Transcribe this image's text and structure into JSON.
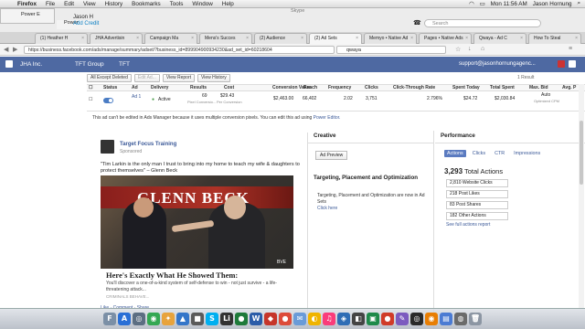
{
  "menubar": {
    "app": "Firefox",
    "items": [
      "File",
      "Edit",
      "View",
      "History",
      "Bookmarks",
      "Tools",
      "Window",
      "Help"
    ],
    "time": "Mon 11:56 AM",
    "user": "Jason Hornung"
  },
  "skype": {
    "title": "Skype",
    "user": "Jason H",
    "add_credit": "Add Credit",
    "search_placeholder": "Search",
    "ff_window": "Power E",
    "ff_window2": "Power"
  },
  "tabs": [
    "(1) Heather H",
    "JHA Advertisin",
    "Campaign Ma",
    "Mens's Succes",
    "(2) Audience",
    "(2) Ad Sets",
    "Memyo • Native Ad",
    "Pages • Native Ads",
    "Qwaya - Ad C",
    "How To Steal"
  ],
  "active_tab": 5,
  "url": "https://business.facebook.com/ads/manage/summary/adset/?business_id=899904900934230&ad_set_id=60218604",
  "search_value": "qwaya",
  "fb": {
    "brand": "JHA Inc.",
    "group": "TFT Group",
    "account": "TFT",
    "email": "support@jasonhornungagenc..."
  },
  "toolbar": {
    "filter": "All Except Deleted",
    "edit": "Edit Ad...",
    "report": "View Report",
    "history": "View History"
  },
  "result_count": "1 Result",
  "table": {
    "headers": [
      "Status",
      "Ad",
      "Delivery",
      "Results",
      "Cost",
      "Conversion Value",
      "Reach",
      "Frequency",
      "Clicks",
      "Click-Through Rate",
      "Spent Today",
      "Total Spent",
      "Max. Bid",
      "Avg. P"
    ],
    "row": {
      "ad": "Ad 1",
      "delivery": "Active",
      "results": "69",
      "results_sub": "Pixel Conversio...",
      "cost": "$29.43",
      "cost_sub": "Per Conversion",
      "conv_value": "$2,463.00",
      "reach": "66,402",
      "frequency": "2.02",
      "clicks": "3,751",
      "ctr": "2.796%",
      "spent_today": "$24.72",
      "total_spent": "$2,030.84",
      "max_bid": "Auto",
      "max_bid_sub": "Optimized CPM"
    }
  },
  "note": {
    "text": "This ad can't be edited in Ads Manager because it uses multiple conversion pixels. You can edit this ad using ",
    "link": "Power Editor."
  },
  "ad": {
    "page": "Target Focus Training",
    "sponsored": "Sponsored",
    "quote": "\"Tim Larkin is the only man I trust to bring into my home to teach my wife & daughters to protect themselves\" – Glenn Beck",
    "banner": "GLENN BECK",
    "watermark": "BVE",
    "headline": "Here's Exactly What He Showed Them:",
    "description": "You'll discover a one-of-a-kind system of self-defense to win - not just survive - a life-threatening attack...",
    "source": "CRIMINALS BEHAVE...",
    "actions": "Like · Comment · Share"
  },
  "creative": {
    "title": "Creative",
    "preview_btn": "Ad Preview",
    "tp_title": "Targeting, Placement and Optimization",
    "tp_text": "Targeting, Placement and Optimization are now in Ad Sets",
    "tp_link": "Click here"
  },
  "performance": {
    "title": "Performance",
    "tabs": [
      "Actions",
      "Clicks",
      "CTR",
      "Impressions"
    ],
    "total_num": "3,293",
    "total_label": "Total Actions",
    "metrics": [
      "2,810 Website Clicks",
      "218 Post Likes",
      "83 Post Shares",
      "182 Other Actions"
    ],
    "link": "See full actions report"
  },
  "dock": [
    {
      "g": "F",
      "c": "#7b8fa6"
    },
    {
      "g": "A",
      "c": "#2a6fd6"
    },
    {
      "g": "◎",
      "c": "#5c6e82"
    },
    {
      "g": "◉",
      "c": "#34a853"
    },
    {
      "g": "✦",
      "c": "#e8a33c"
    },
    {
      "g": "▲",
      "c": "#3576c9"
    },
    {
      "g": "■",
      "c": "#5a5a5a"
    },
    {
      "g": "S",
      "c": "#00aff0"
    },
    {
      "g": "Li",
      "c": "#333"
    },
    {
      "g": "●",
      "c": "#1e7a3a"
    },
    {
      "g": "W",
      "c": "#2b5ca8"
    },
    {
      "g": "◆",
      "c": "#c6352a"
    },
    {
      "g": "●",
      "c": "#dd4b39"
    },
    {
      "g": "✉",
      "c": "#6a9bd8"
    },
    {
      "g": "◐",
      "c": "#f0b400"
    },
    {
      "g": "♫",
      "c": "#fa3c7a"
    },
    {
      "g": "◈",
      "c": "#2f6db5"
    },
    {
      "g": "◧",
      "c": "#444"
    },
    {
      "g": "▣",
      "c": "#1e8a4a"
    },
    {
      "g": "●",
      "c": "#d03b28"
    },
    {
      "g": "✎",
      "c": "#7c5bbf"
    },
    {
      "g": "◎",
      "c": "#2a2a2a"
    },
    {
      "g": "◉",
      "c": "#e87e04"
    },
    {
      "g": "▤",
      "c": "#4b7bd3"
    },
    {
      "g": "◍",
      "c": "#6b6b6b"
    },
    {
      "g": "🗑",
      "c": "#8c96a3"
    }
  ]
}
